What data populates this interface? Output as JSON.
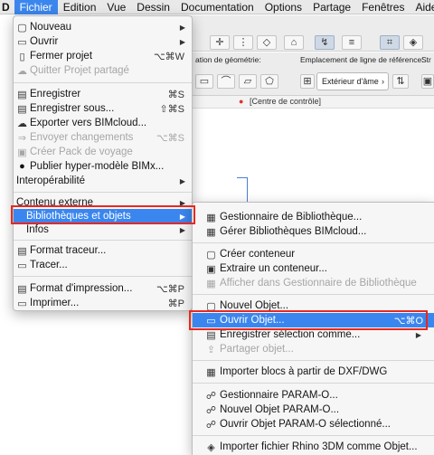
{
  "menubar": {
    "app": "D",
    "items": [
      "Fichier",
      "Edition",
      "Vue",
      "Dessin",
      "Documentation",
      "Options",
      "Partage",
      "Fenêtres",
      "Aide"
    ]
  },
  "background": {
    "panel_label_geometry": "ation de géométrie:",
    "panel_label_reference": "Emplacement de ligne de référence:",
    "panel_label_str": "Str",
    "reference_value": "Extérieur d'âme",
    "control_center": "[Centre de contrôle]"
  },
  "fichier_menu": {
    "items": [
      {
        "label": "Nouveau",
        "icon": "new-icon",
        "arrow": "▶"
      },
      {
        "label": "Ouvrir",
        "icon": "open-folder-icon",
        "arrow": "▶"
      },
      {
        "label": "Fermer projet",
        "icon": "close-project-icon",
        "shortcut": "⌥⌘W"
      },
      {
        "label": "Quitter Projet partagé",
        "icon": "leave-teamwork-icon",
        "disabled": true
      },
      {
        "label": "Enregistrer",
        "icon": "save-icon",
        "shortcut": "⌘S"
      },
      {
        "label": "Enregistrer sous...",
        "icon": "save-as-icon",
        "shortcut": "⇧⌘S"
      },
      {
        "label": "Exporter vers BIMcloud...",
        "icon": "export-bimcloud-icon"
      },
      {
        "label": "Envoyer changements",
        "icon": "send-changes-icon",
        "shortcut": "⌥⌘S",
        "disabled": true
      },
      {
        "label": "Créer Pack de voyage",
        "icon": "travel-pack-icon",
        "disabled": true
      },
      {
        "label": "Publier hyper-modèle BIMx...",
        "icon": "bimx-icon"
      },
      {
        "label": "Interopérabilité",
        "arrow": "▶"
      },
      {
        "label": "Contenu externe",
        "arrow": "▶"
      },
      {
        "label": "Bibliothèques et objets",
        "arrow": "▶",
        "highlighted": true
      },
      {
        "label": "Infos",
        "arrow": "▶"
      },
      {
        "label": "Format traceur...",
        "icon": "plotter-setup-icon"
      },
      {
        "label": "Tracer...",
        "icon": "plot-icon"
      },
      {
        "label": "Format d'impression...",
        "icon": "page-setup-icon",
        "shortcut": "⌥⌘P"
      },
      {
        "label": "Imprimer...",
        "icon": "print-icon",
        "shortcut": "⌘P"
      }
    ]
  },
  "libraries_submenu": {
    "items": [
      {
        "label": "Gestionnaire de Bibliothèque...",
        "icon": "library-manager-icon"
      },
      {
        "label": "Gérer Bibliothèques BIMcloud...",
        "icon": "bimcloud-libraries-icon"
      },
      {
        "label": "Créer conteneur",
        "icon": "create-container-icon"
      },
      {
        "label": "Extraire un conteneur...",
        "icon": "extract-container-icon"
      },
      {
        "label": "Afficher dans Gestionnaire de Bibliothèque",
        "icon": "show-in-library-icon",
        "disabled": true
      },
      {
        "label": "Nouvel Objet...",
        "icon": "new-object-icon"
      },
      {
        "label": "Ouvrir Objet...",
        "icon": "open-object-icon",
        "shortcut": "⌥⌘O",
        "highlighted": true
      },
      {
        "label": "Enregistrer sélection comme...",
        "icon": "save-selection-icon",
        "arrow": "▶"
      },
      {
        "label": "Partager objet...",
        "icon": "share-object-icon",
        "disabled": true
      },
      {
        "label": "Importer blocs à partir de DXF/DWG",
        "icon": "import-dxf-icon"
      },
      {
        "label": "Gestionnaire PARAM-O...",
        "icon": "param-o-manager-icon"
      },
      {
        "label": "Nouvel Objet PARAM-O...",
        "icon": "new-param-o-icon"
      },
      {
        "label": "Ouvrir Objet PARAM-O sélectionné...",
        "icon": "open-param-o-icon"
      },
      {
        "label": "Importer fichier Rhino 3DM comme Objet...",
        "icon": "import-rhino-icon"
      }
    ]
  },
  "colors": {
    "highlight": "#3b86ee",
    "callout": "#e8281e"
  }
}
